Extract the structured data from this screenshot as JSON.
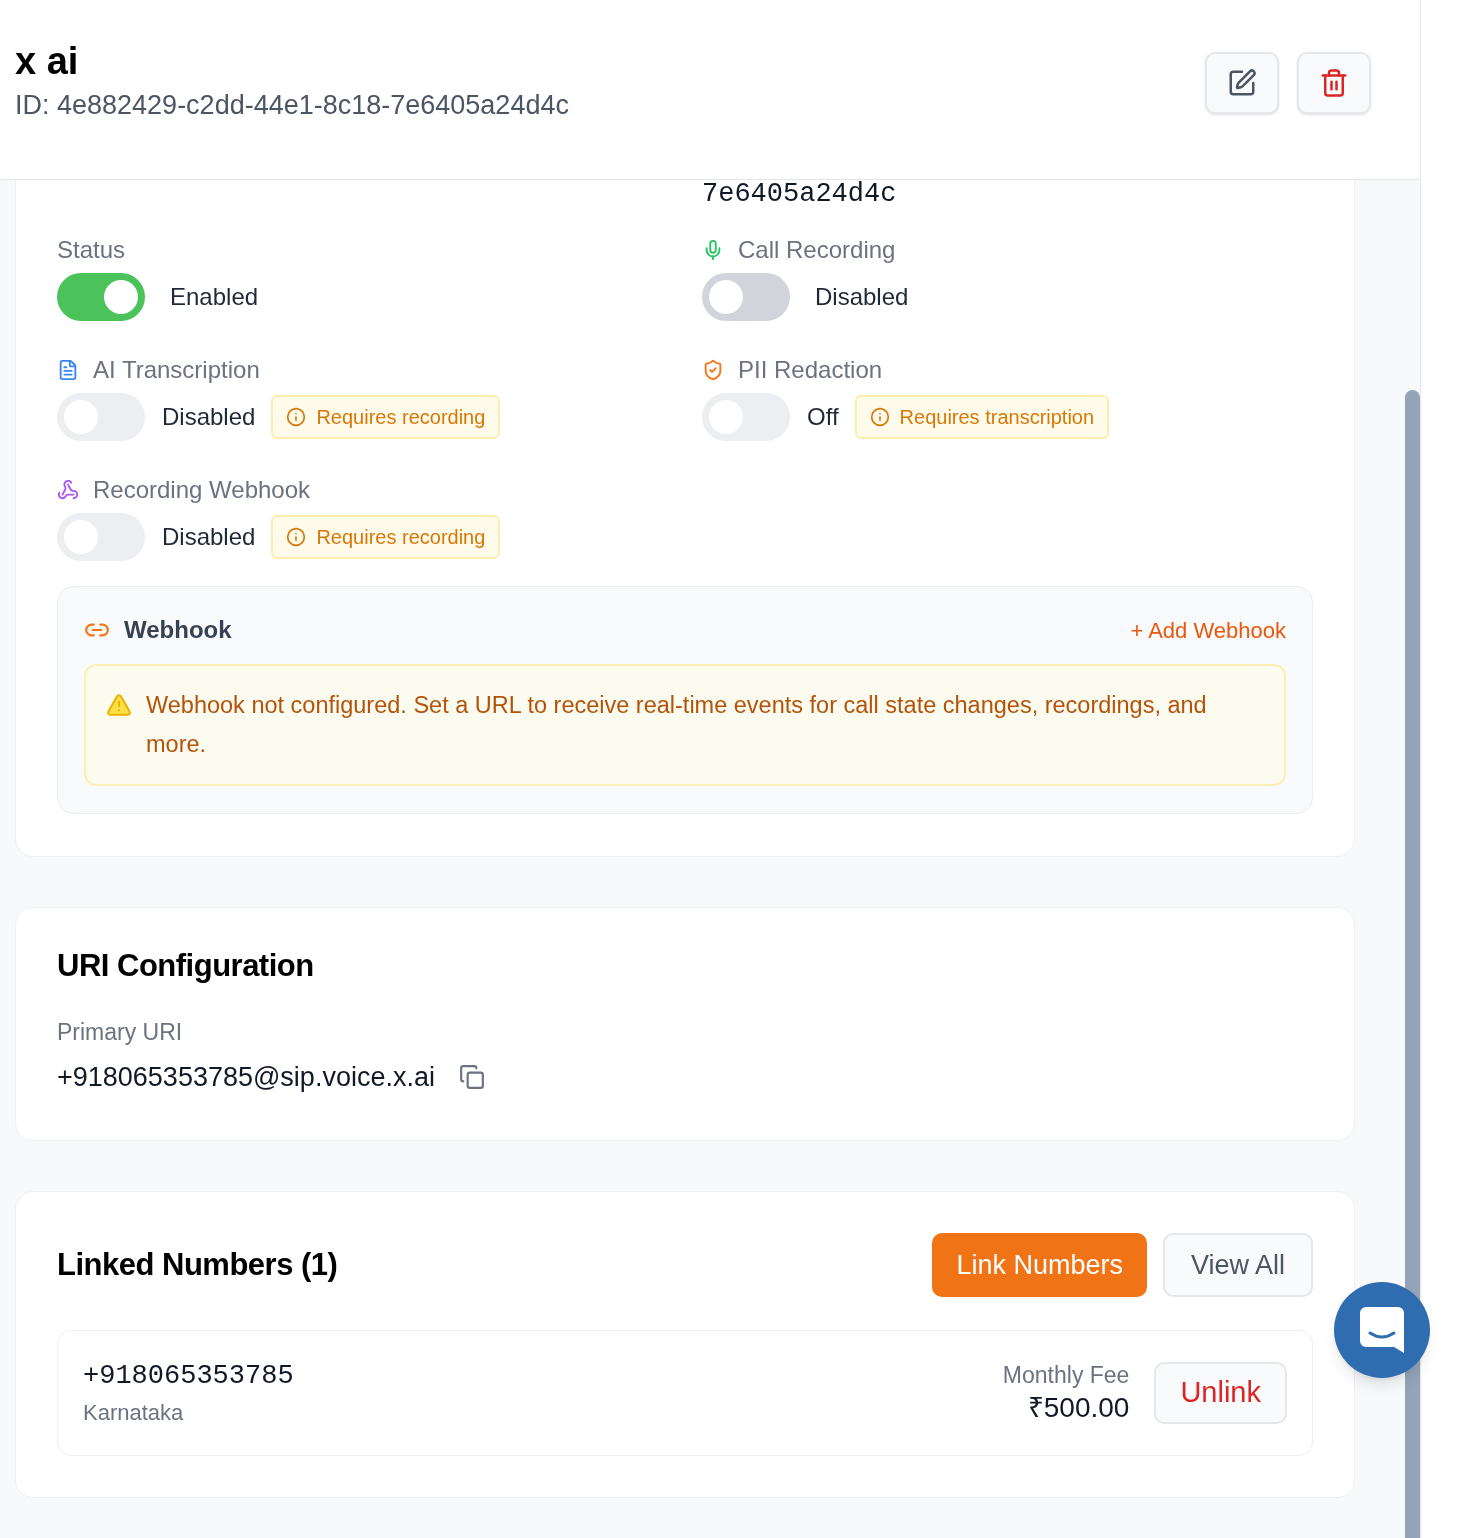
{
  "header": {
    "title": "x ai",
    "id": "ID: 4e882429-c2dd-44e1-8c18-7e6405a24d4c"
  },
  "settings": {
    "cut_text": "7e6405a24d4c",
    "items": [
      {
        "label": "Status",
        "on": true,
        "disabled": false,
        "state": "Enabled"
      },
      {
        "label": "Call Recording",
        "on": false,
        "disabled": false,
        "state": "Disabled"
      },
      {
        "label": "AI Transcription",
        "on": false,
        "disabled": true,
        "state": "Disabled",
        "note": "Requires recording"
      },
      {
        "label": "PII Redaction",
        "on": false,
        "disabled": true,
        "state": "Off",
        "note": "Requires transcription"
      },
      {
        "label": "Recording Webhook",
        "on": false,
        "disabled": true,
        "state": "Disabled",
        "note": "Requires recording"
      }
    ]
  },
  "webhook": {
    "title": "Webhook",
    "action": "+ Add Webhook",
    "warning": "Webhook not configured. Set a URL to receive real-time events for call state changes, recordings, and more."
  },
  "uri": {
    "title": "URI Configuration",
    "label": "Primary URI",
    "value": "+918065353785@sip.voice.x.ai"
  },
  "linked": {
    "title": "Linked Numbers (1)",
    "buttons": [
      "Link Numbers",
      "View All"
    ],
    "numbers": [
      {
        "number": "+918065353785",
        "region": "Karnataka",
        "fee_label": "Monthly Fee",
        "fee": "₹500.00",
        "action": "Unlink"
      }
    ]
  }
}
